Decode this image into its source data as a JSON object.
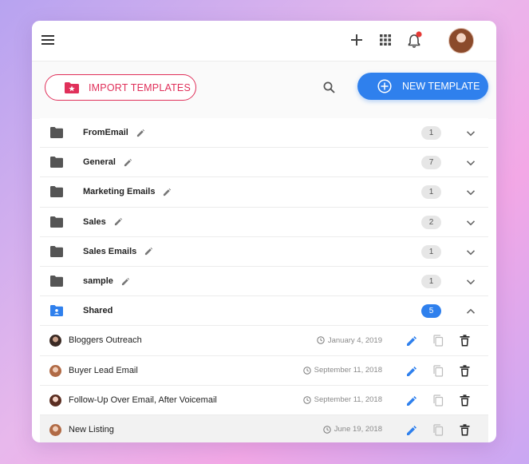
{
  "toolbar": {
    "import_label": "IMPORT TEMPLATES",
    "new_label": "NEW TEMPLATE"
  },
  "colors": {
    "accent_blue": "#2f80ed",
    "accent_pink": "#e0305a",
    "notification_dot": "#e53935"
  },
  "folders": [
    {
      "name": "FromEmail",
      "count": "1"
    },
    {
      "name": "General",
      "count": "7"
    },
    {
      "name": "Marketing Emails",
      "count": "1"
    },
    {
      "name": "Sales",
      "count": "2"
    },
    {
      "name": "Sales Emails",
      "count": "1"
    },
    {
      "name": "sample",
      "count": "1"
    }
  ],
  "shared": {
    "name": "Shared",
    "count": "5",
    "expanded": true
  },
  "templates": [
    {
      "name": "Bloggers Outreach",
      "date": "January 4, 2019"
    },
    {
      "name": "Buyer Lead Email",
      "date": "September 11, 2018"
    },
    {
      "name": "Follow-Up Over Email, After Voicemail",
      "date": "September 11, 2018"
    },
    {
      "name": "New Listing",
      "date": "June 19, 2018"
    }
  ]
}
